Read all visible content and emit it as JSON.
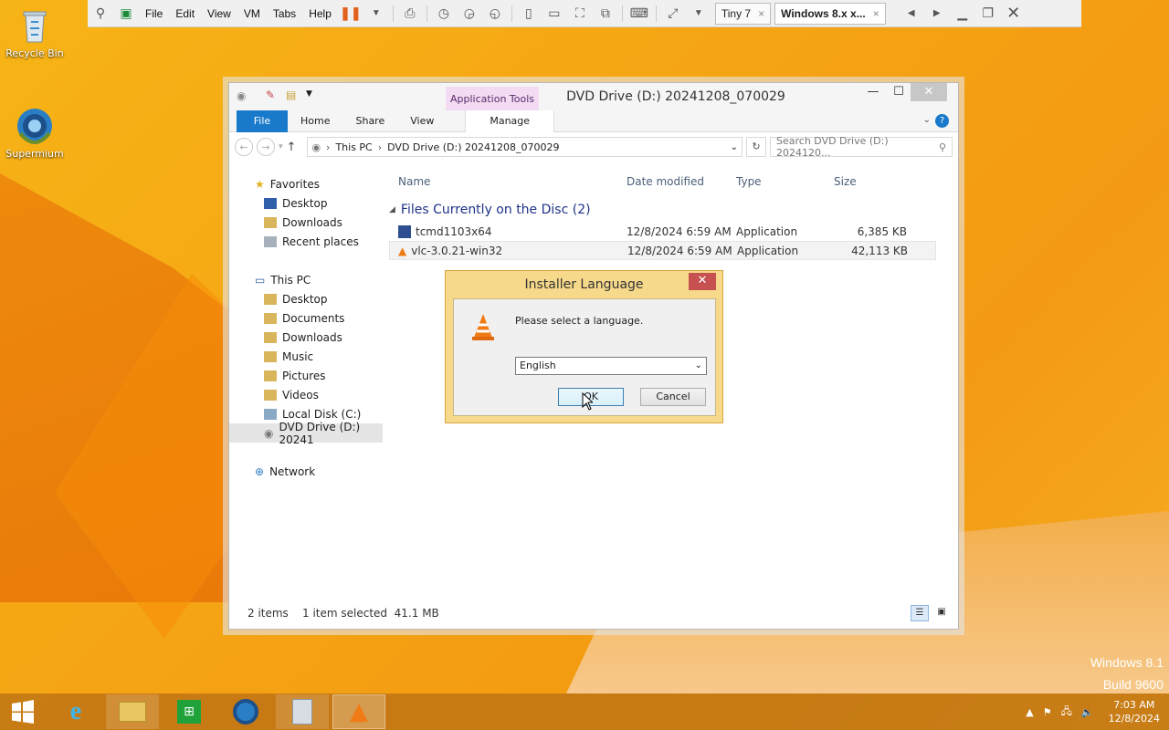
{
  "desktop": {
    "icons": [
      {
        "label": "Recycle Bin"
      },
      {
        "label": "Supermium"
      }
    ],
    "watermark": {
      "line1": "Windows 8.1",
      "line2": "Build 9600"
    }
  },
  "vm": {
    "menu": [
      "File",
      "Edit",
      "View",
      "VM",
      "Tabs",
      "Help"
    ],
    "tabs": [
      {
        "label": "Tiny 7"
      },
      {
        "label": "Windows 8.x x..."
      }
    ]
  },
  "explorer": {
    "contextual_tab": "Application Tools",
    "title": "DVD Drive (D:) 20241208_070029",
    "ribbon": {
      "file": "File",
      "home": "Home",
      "share": "Share",
      "view": "View",
      "manage": "Manage"
    },
    "address": {
      "crumbs": [
        "This PC",
        "DVD Drive (D:) 20241208_070029"
      ],
      "search_placeholder": "Search DVD Drive (D:) 2024120..."
    },
    "nav": {
      "favorites": "Favorites",
      "fav_items": [
        "Desktop",
        "Downloads",
        "Recent places"
      ],
      "thispc": "This PC",
      "pc_items": [
        "Desktop",
        "Documents",
        "Downloads",
        "Music",
        "Pictures",
        "Videos",
        "Local Disk (C:)",
        "DVD Drive (D:) 20241"
      ],
      "network": "Network"
    },
    "columns": {
      "name": "Name",
      "date": "Date modified",
      "type": "Type",
      "size": "Size"
    },
    "group": "Files Currently on the Disc (2)",
    "files": [
      {
        "name": "tcmd1103x64",
        "date": "12/8/2024 6:59 AM",
        "type": "Application",
        "size": "6,385 KB"
      },
      {
        "name": "vlc-3.0.21-win32",
        "date": "12/8/2024 6:59 AM",
        "type": "Application",
        "size": "42,113 KB"
      }
    ],
    "status": {
      "count": "2 items",
      "selected": "1 item selected  41.1 MB"
    }
  },
  "dialog": {
    "title": "Installer Language",
    "prompt": "Please select a language.",
    "language": "English",
    "ok": "OK",
    "cancel": "Cancel"
  },
  "clock": {
    "time": "7:03 AM",
    "date": "12/8/2024"
  },
  "colors": {
    "file_tab": "#1979ca",
    "dialog_frame": "#f6d98a",
    "close_red": "#c75050",
    "wallpaper": "#f5a514"
  }
}
